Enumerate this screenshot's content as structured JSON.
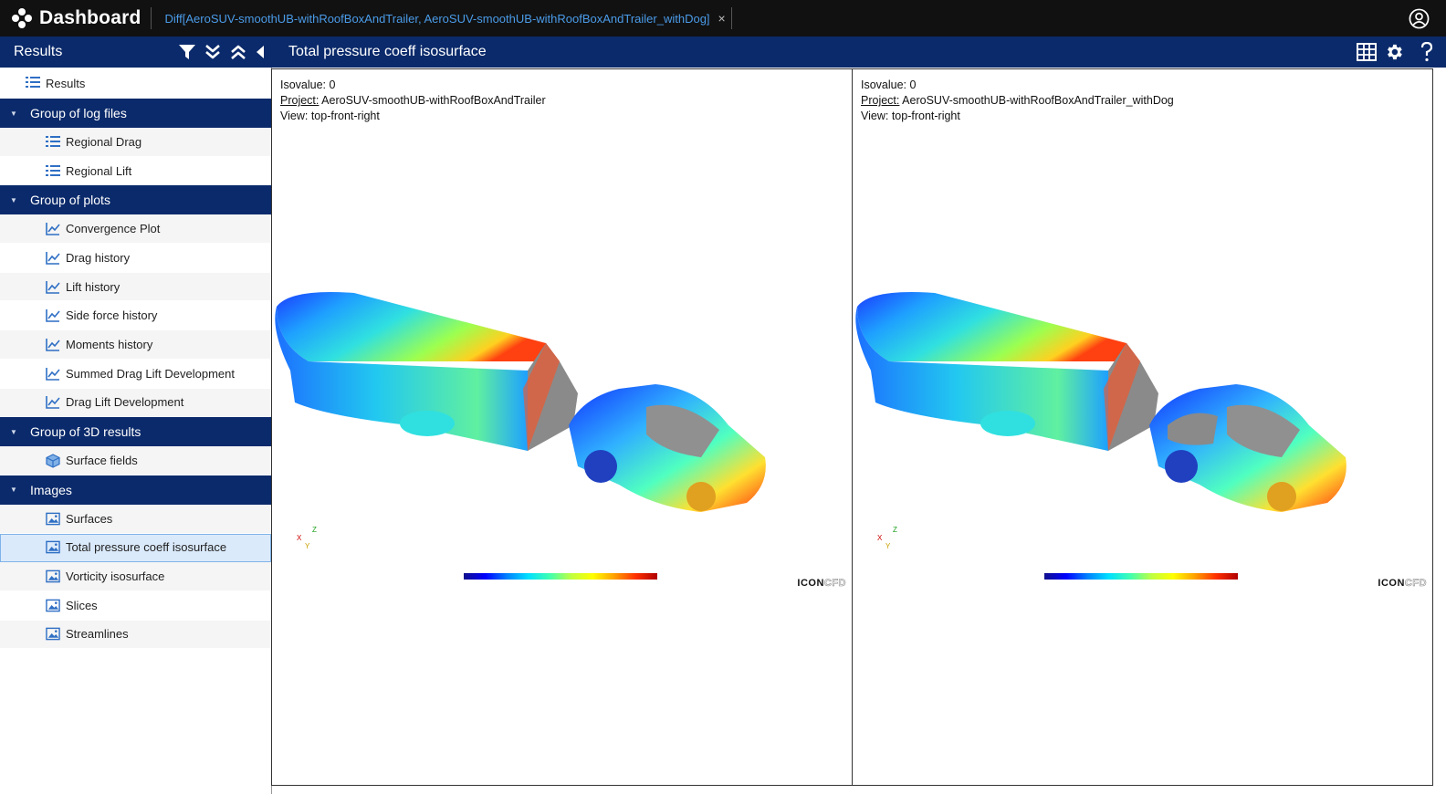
{
  "app": {
    "title": "Dashboard"
  },
  "tab": {
    "label": "Diff[AeroSUV-smoothUB-withRoofBoxAndTrailer, AeroSUV-smoothUB-withRoofBoxAndTrailer_withDog]",
    "close": "×"
  },
  "header": {
    "results_title": "Results",
    "view_title": "Total pressure coeff isosurface"
  },
  "sidebar": {
    "root": "Results",
    "groups": [
      {
        "label": "Group of log files",
        "items": [
          {
            "label": "Regional Drag",
            "icon": "list-icon"
          },
          {
            "label": "Regional Lift",
            "icon": "list-icon"
          }
        ]
      },
      {
        "label": "Group of plots",
        "items": [
          {
            "label": "Convergence Plot",
            "icon": "line-chart-icon"
          },
          {
            "label": "Drag history",
            "icon": "line-chart-icon"
          },
          {
            "label": "Lift history",
            "icon": "line-chart-icon"
          },
          {
            "label": "Side force history",
            "icon": "line-chart-icon"
          },
          {
            "label": "Moments history",
            "icon": "line-chart-icon"
          },
          {
            "label": "Summed Drag Lift Development",
            "icon": "line-chart-icon"
          },
          {
            "label": "Drag Lift Development",
            "icon": "line-chart-icon"
          }
        ]
      },
      {
        "label": "Group of 3D results",
        "items": [
          {
            "label": "Surface fields",
            "icon": "cube-icon"
          }
        ]
      },
      {
        "label": "Images",
        "items": [
          {
            "label": "Surfaces",
            "icon": "image-icon"
          },
          {
            "label": "Total pressure coeff isosurface",
            "icon": "image-icon",
            "selected": true
          },
          {
            "label": "Vorticity isosurface",
            "icon": "image-icon"
          },
          {
            "label": "Slices",
            "icon": "image-icon"
          },
          {
            "label": "Streamlines",
            "icon": "image-icon"
          }
        ]
      }
    ]
  },
  "panels": [
    {
      "isovalue_label": "Isovalue: 0",
      "project_key": "Project:",
      "project_value": " AeroSUV-smoothUB-withRoofBoxAndTrailer",
      "view_label": "View: top-front-right"
    },
    {
      "isovalue_label": "Isovalue: 0",
      "project_key": "Project:",
      "project_value": " AeroSUV-smoothUB-withRoofBoxAndTrailer_withDog",
      "view_label": "View: top-front-right"
    }
  ],
  "viz": {
    "axis_z": "Z",
    "axis_x": "X",
    "axis_y": "Y",
    "brand_icon": "ICON",
    "brand_cfd": "CFD"
  },
  "colors": {
    "topbar": "#111111",
    "header": "#0b2a6b",
    "accent_link": "#4a9be8",
    "selected_row": "#dbeafb"
  }
}
